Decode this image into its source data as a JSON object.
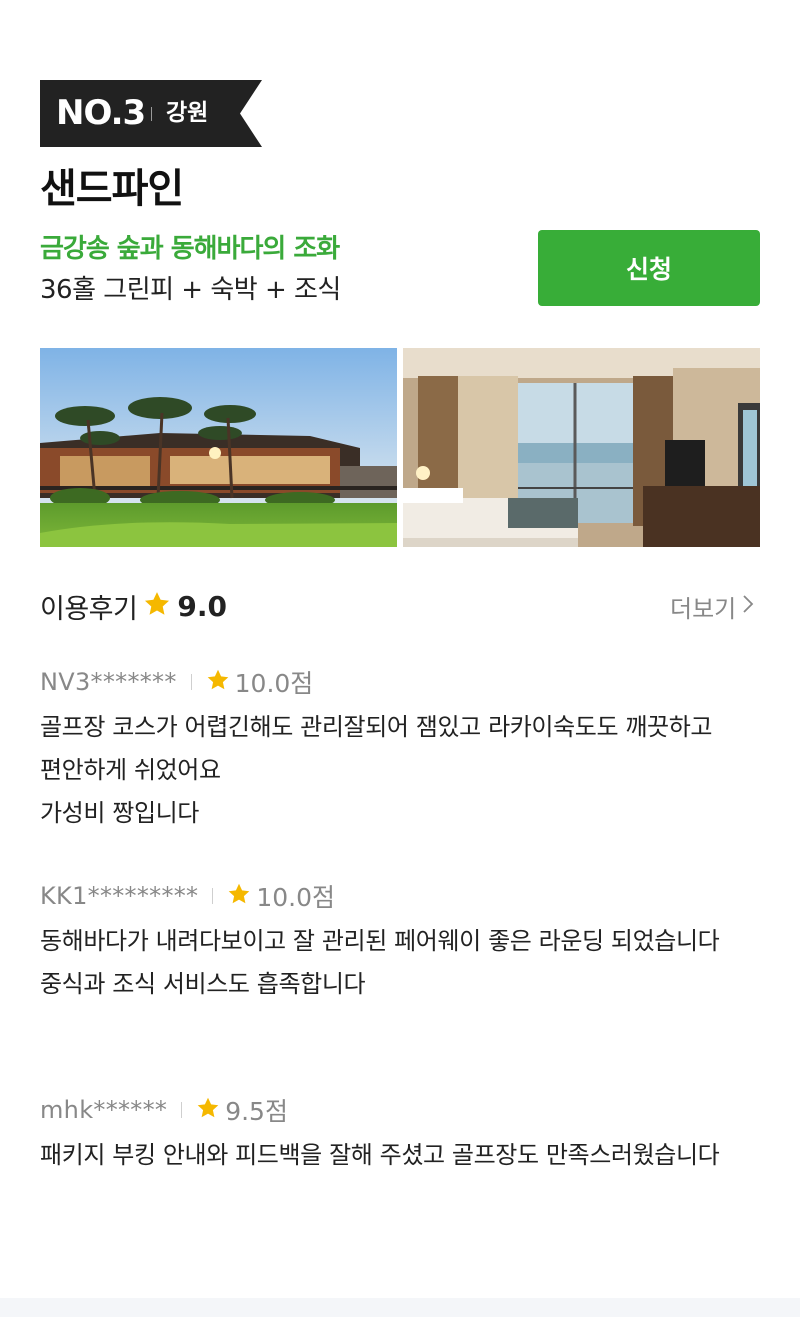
{
  "badge": {
    "rank": "NO.3",
    "region": "강원"
  },
  "product": {
    "title": "샌드파인",
    "tagline": "금강송 숲과 동해바다의 조화",
    "package": "36홀 그린피 + 숙박 + 조식",
    "apply_label": "신청"
  },
  "photos": [
    {
      "name": "clubhouse-photo"
    },
    {
      "name": "hotel-room-photo"
    }
  ],
  "reviews_section": {
    "label": "이용후기",
    "score": "9.0",
    "more_label": "더보기"
  },
  "reviews": [
    {
      "user": "NV3*******",
      "score": "10.0점",
      "text": "골프장 코스가 어렵긴해도 관리잘되어 잼있고 라카이숙도도 깨끗하고 편안하게 쉬었어요\n가성비 짱입니다"
    },
    {
      "user": "KK1*********",
      "score": "10.0점",
      "text": "동해바다가 내려다보이고 잘 관리된 페어웨이 좋은 라운딩 되었습니다\n중식과 조식 서비스도 흡족합니다"
    },
    {
      "user": "mhk******",
      "score": "9.5점",
      "text": "패키지 부킹 안내와 피드백을 잘해 주셨고 골프장도 만족스러웠습니다"
    }
  ],
  "colors": {
    "accent_green": "#38ad38",
    "star": "#f5b800",
    "badge_bg": "#222222"
  }
}
